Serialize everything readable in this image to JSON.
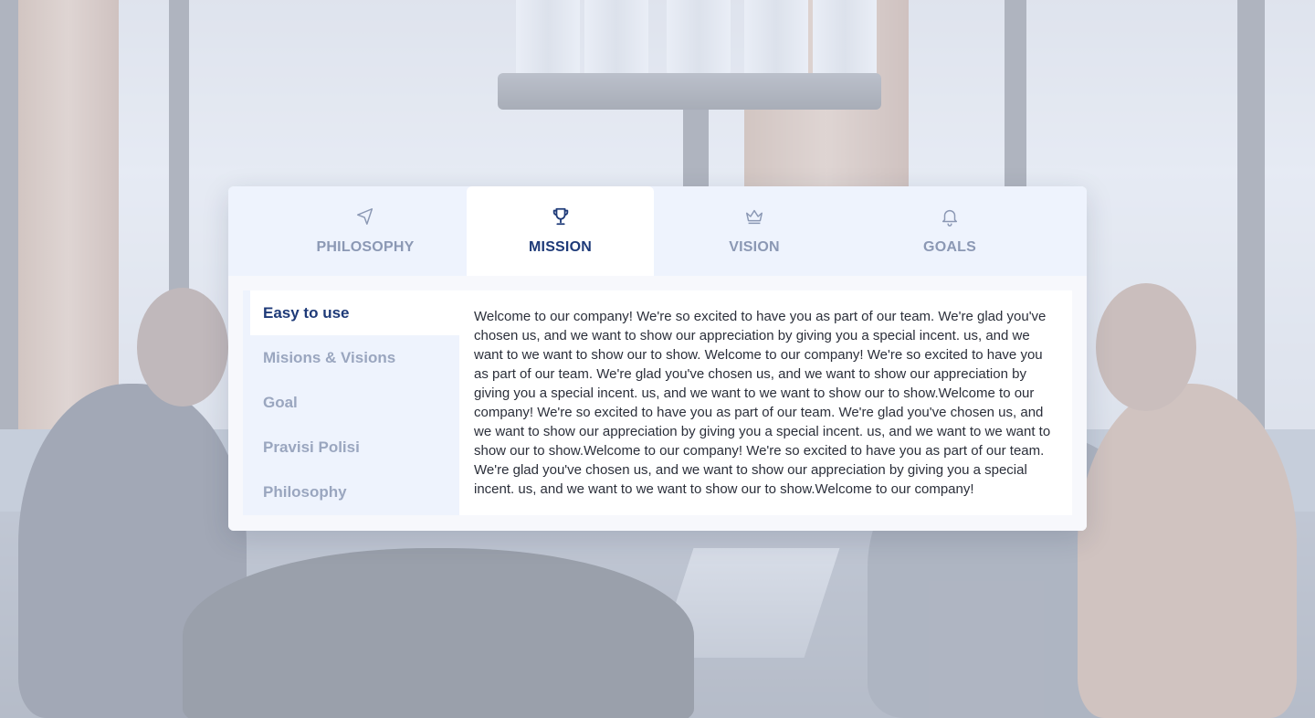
{
  "tabs": [
    {
      "label": "PHILOSOPHY",
      "icon": "navigation-arrow-icon",
      "active": false
    },
    {
      "label": "MISSION",
      "icon": "trophy-icon",
      "active": true
    },
    {
      "label": "VISION",
      "icon": "crown-icon",
      "active": false
    },
    {
      "label": "GOALS",
      "icon": "bell-icon",
      "active": false
    }
  ],
  "sidebar": {
    "items": [
      {
        "label": "Easy to use",
        "active": true
      },
      {
        "label": "Misions & Visions",
        "active": false
      },
      {
        "label": "Goal",
        "active": false
      },
      {
        "label": "Pravisi Polisi",
        "active": false
      },
      {
        "label": "Philosophy",
        "active": false
      }
    ]
  },
  "content": {
    "text": "Welcome to our company! We're so excited to have you as part of our team. We're glad you've chosen us, and we want to show our appreciation by giving you a special incent. us, and we want to we want to show our to show. Welcome to our company! We're so excited to have you as part of our team. We're glad you've chosen us, and we want to show our appreciation by giving you a special incent. us, and we want to we want to show our to show.Welcome to our company! We're so excited to have you as part of our team. We're glad you've chosen us, and we want to show our appreciation by giving you a special incent. us, and we want to we want to show our to show.Welcome to our company! We're so excited to have you as part of our team. We're glad you've chosen us, and we want to show our appreciation by giving you a special incent. us, and we want to we want to show our to show.Welcome to our company!"
  },
  "colors": {
    "accent": "#1e3a78",
    "muted": "#8b98b4",
    "tab_bar_bg": "#eef3fd"
  }
}
